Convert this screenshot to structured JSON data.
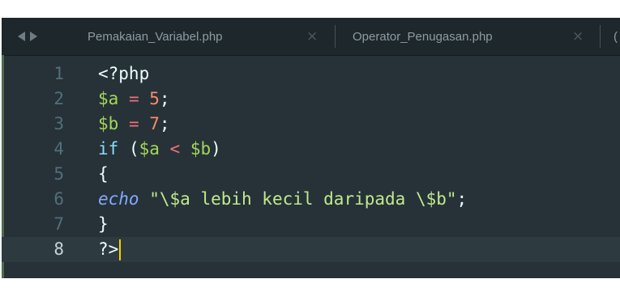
{
  "tabs": [
    {
      "label": "Pemakaian_Variabel.php",
      "close": "×"
    },
    {
      "label": "Operator_Penugasan.php",
      "close": "×"
    }
  ],
  "tab_overflow_label": "(",
  "lines": [
    {
      "number": "1",
      "tokens": [
        {
          "t": "plain",
          "v": "<?php"
        }
      ]
    },
    {
      "number": "2",
      "tokens": [
        {
          "t": "var",
          "v": "$a"
        },
        {
          "t": "plain",
          "v": " "
        },
        {
          "t": "op",
          "v": "="
        },
        {
          "t": "plain",
          "v": " "
        },
        {
          "t": "num",
          "v": "5"
        },
        {
          "t": "plain",
          "v": ";"
        }
      ]
    },
    {
      "number": "3",
      "tokens": [
        {
          "t": "var",
          "v": "$b"
        },
        {
          "t": "plain",
          "v": " "
        },
        {
          "t": "op",
          "v": "="
        },
        {
          "t": "plain",
          "v": " "
        },
        {
          "t": "num",
          "v": "7"
        },
        {
          "t": "plain",
          "v": ";"
        }
      ]
    },
    {
      "number": "4",
      "tokens": [
        {
          "t": "kw",
          "v": "if"
        },
        {
          "t": "plain",
          "v": " ("
        },
        {
          "t": "var",
          "v": "$a"
        },
        {
          "t": "plain",
          "v": " "
        },
        {
          "t": "op",
          "v": "<"
        },
        {
          "t": "plain",
          "v": " "
        },
        {
          "t": "var",
          "v": "$b"
        },
        {
          "t": "plain",
          "v": ")"
        }
      ]
    },
    {
      "number": "5",
      "tokens": [
        {
          "t": "plain",
          "v": "{"
        }
      ]
    },
    {
      "number": "6",
      "tokens": [
        {
          "t": "builtin",
          "v": "echo"
        },
        {
          "t": "plain",
          "v": " "
        },
        {
          "t": "str",
          "v": "\"\\$a lebih kecil daripada \\$b\""
        },
        {
          "t": "plain",
          "v": ";"
        }
      ]
    },
    {
      "number": "7",
      "tokens": [
        {
          "t": "plain",
          "v": "}"
        }
      ]
    },
    {
      "number": "8",
      "tokens": [
        {
          "t": "plain",
          "v": "?>"
        }
      ],
      "active": true
    }
  ],
  "colors": {
    "background": "#263238",
    "variable": "#a5d55a",
    "operator": "#f07178",
    "number": "#f78c6c",
    "keyword": "#89ddff",
    "string": "#c3e88d",
    "cursor": "#ffcc00"
  }
}
